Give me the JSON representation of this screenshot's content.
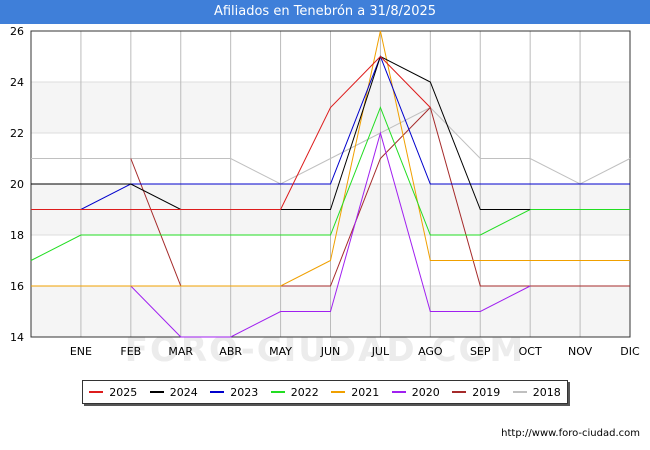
{
  "header": {
    "title": "Afiliados en Tenebrón a 31/8/2025"
  },
  "footer": {
    "url": "http://www.foro-ciudad.com"
  },
  "watermark": {
    "text": "FORO-CIUDAD.COM"
  },
  "chart_data": {
    "type": "line",
    "title": "Afiliados en Tenebrón a 31/8/2025",
    "xlabel": "",
    "ylabel": "",
    "categories": [
      "",
      "ENE",
      "FEB",
      "MAR",
      "ABR",
      "MAY",
      "JUN",
      "JUL",
      "AGO",
      "SEP",
      "OCT",
      "NOV",
      "DIC"
    ],
    "ylim": [
      14,
      26
    ],
    "yticks": [
      14,
      16,
      18,
      20,
      22,
      24,
      26
    ],
    "grid": true,
    "legend_position": "bottom",
    "series": [
      {
        "name": "2025",
        "color": "#dd1c1c",
        "values": [
          19,
          19,
          19,
          19,
          19,
          19,
          23,
          25,
          23,
          null,
          null,
          null,
          null
        ]
      },
      {
        "name": "2024",
        "color": "#000000",
        "values": [
          20,
          20,
          20,
          19,
          19,
          19,
          19,
          25,
          24,
          19,
          19,
          null,
          null
        ]
      },
      {
        "name": "2023",
        "color": "#0000cc",
        "values": [
          19,
          19,
          20,
          20,
          20,
          20,
          20,
          25,
          20,
          20,
          20,
          20,
          20
        ]
      },
      {
        "name": "2022",
        "color": "#22dd22",
        "values": [
          17,
          18,
          18,
          18,
          18,
          18,
          18,
          23,
          18,
          18,
          19,
          19,
          19
        ]
      },
      {
        "name": "2021",
        "color": "#f0a000",
        "values": [
          16,
          16,
          16,
          16,
          16,
          16,
          17,
          26,
          17,
          17,
          17,
          17,
          17
        ]
      },
      {
        "name": "2020",
        "color": "#a020f0",
        "values": [
          16,
          16,
          16,
          14,
          14,
          15,
          15,
          22,
          15,
          15,
          16,
          null,
          null
        ]
      },
      {
        "name": "2019",
        "color": "#a52a2a",
        "values": [
          null,
          null,
          21,
          16,
          16,
          16,
          16,
          21,
          23,
          16,
          16,
          16,
          16
        ]
      },
      {
        "name": "2018",
        "color": "#c0c0c0",
        "values": [
          21,
          21,
          21,
          21,
          21,
          20,
          21,
          22,
          23,
          21,
          21,
          20,
          21
        ]
      }
    ]
  }
}
